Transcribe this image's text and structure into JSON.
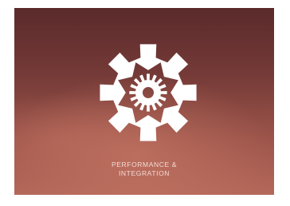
{
  "tile": {
    "icon": "gear-icon",
    "caption_line1": "PERFORMANCE &",
    "caption_line2": "INTEGRATION"
  },
  "colors": {
    "background_top": "#5a2a2b",
    "background_bottom": "#b4685a",
    "icon": "#ffffff",
    "caption": "#f2dcd6"
  }
}
